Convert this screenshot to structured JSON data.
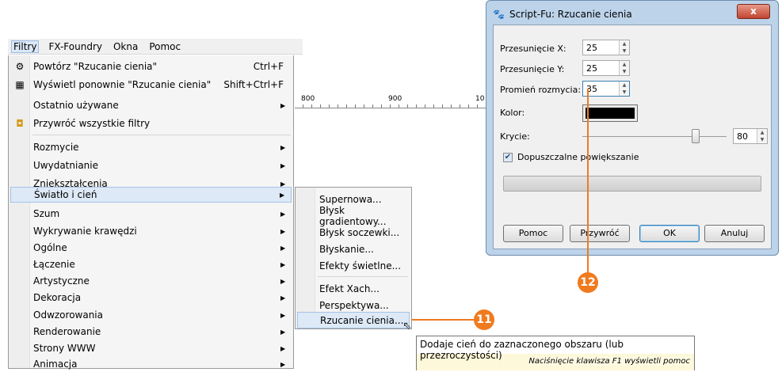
{
  "menubar": {
    "items": [
      "Filtry",
      "FX-Foundry",
      "Okna",
      "Pomoc"
    ]
  },
  "filters_menu": {
    "repeat": {
      "label": "Powtórz \"Rzucanie cienia\"",
      "shortcut": "Ctrl+F"
    },
    "reshow": {
      "label": "Wyświetl ponownie \"Rzucanie cienia\"",
      "shortcut": "Shift+Ctrl+F"
    },
    "recent": "Ostatnio używane",
    "reset": "Przywróć wszystkie filtry",
    "categories": [
      "Rozmycie",
      "Uwydatnianie",
      "Zniekształcenia",
      "Światło i cień",
      "Szum",
      "Wykrywanie krawędzi",
      "Ogólne",
      "Łączenie",
      "Artystyczne",
      "Dekoracja",
      "Odwzorowania",
      "Renderowanie",
      "Strony WWW",
      "Animacja"
    ]
  },
  "submenu": {
    "group1": [
      "Supernowa...",
      "Błysk gradientowy...",
      "Błysk soczewki...",
      "Błyskanie...",
      "Efekty świetlne..."
    ],
    "group2": [
      "Efekt Xach...",
      "Perspektywa...",
      "Rzucanie cienia..."
    ]
  },
  "ruler": {
    "labels": [
      "800",
      "900",
      "10"
    ]
  },
  "dialog": {
    "title": "Script-Fu: Rzucanie cienia",
    "close": "x",
    "offset_x": {
      "label": "Przesunięcie X:",
      "value": "25"
    },
    "offset_y": {
      "label": "Przesunięcie Y:",
      "value": "25"
    },
    "blur": {
      "label": "Promień rozmycia:",
      "value": "35"
    },
    "color": {
      "label": "Kolor:",
      "value": "#000000"
    },
    "opacity": {
      "label": "Krycie:",
      "value": "80",
      "level_percent": 80
    },
    "allow_resize": {
      "label": "Dopuszczalne powiększanie",
      "checked": true
    },
    "buttons": {
      "help": "Pomoc",
      "reset": "Przywróć",
      "ok": "OK",
      "cancel": "Anuluj"
    }
  },
  "tooltip": {
    "text": "Dodaje cień do zaznaczonego obszaru (lub przezroczystości)",
    "hint": "Naciśnięcie klawisza F1 wyświetli pomoc"
  },
  "callouts": {
    "c11": "11",
    "c12": "12"
  },
  "colors": {
    "accent": "#f07a1e",
    "highlight": "#dde9f6"
  }
}
